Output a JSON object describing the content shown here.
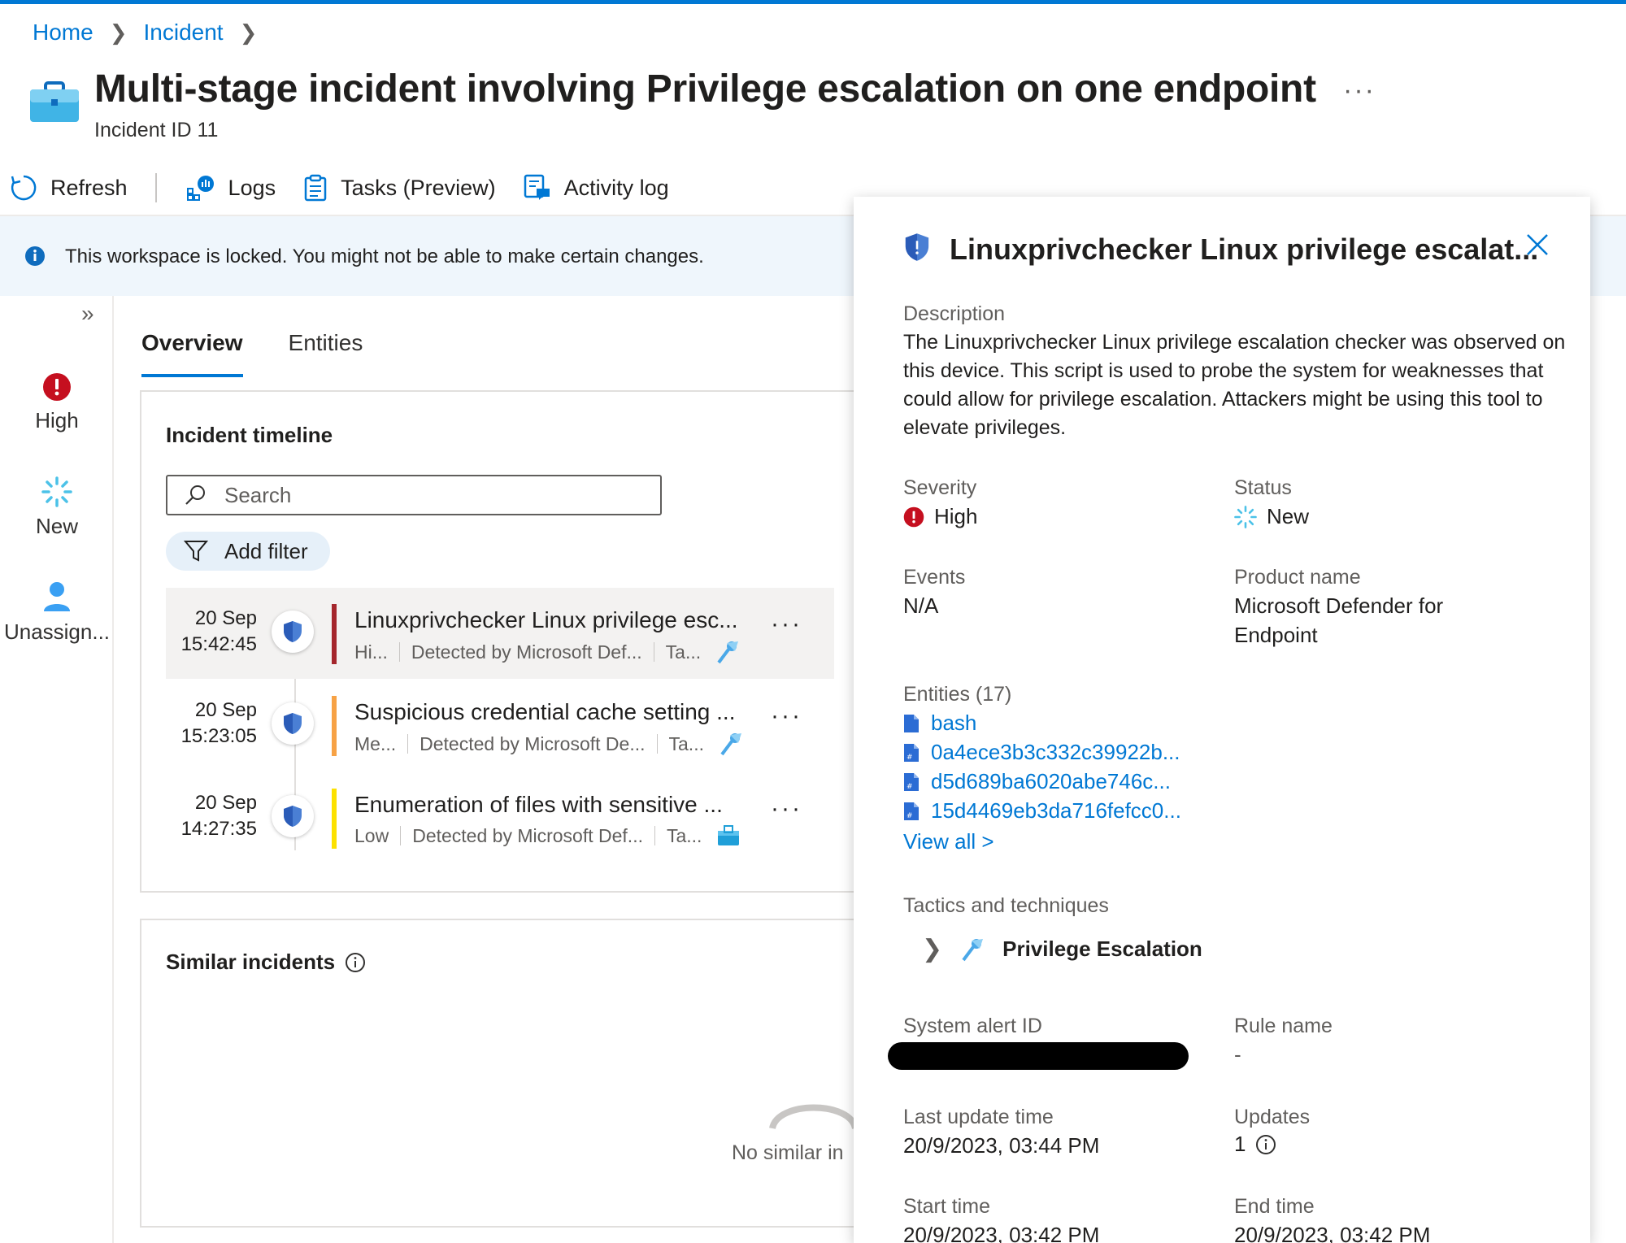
{
  "breadcrumb": {
    "home": "Home",
    "incident": "Incident"
  },
  "header": {
    "title": "Multi-stage incident involving Privilege escalation on one endpoint",
    "subtitle": "Incident ID 11",
    "more": "···"
  },
  "toolbar": {
    "refresh": "Refresh",
    "logs": "Logs",
    "tasks": "Tasks (Preview)",
    "activity": "Activity log"
  },
  "banner": {
    "text": "This workspace is locked. You might not be able to make certain changes."
  },
  "rail": {
    "severity": "High",
    "status": "New",
    "owner": "Unassign..."
  },
  "tabs": [
    "Overview",
    "Entities"
  ],
  "timeline": {
    "title": "Incident timeline",
    "search_placeholder": "Search",
    "add_filter": "Add filter",
    "alerts": [
      {
        "date": "20 Sep",
        "time": "15:42:45",
        "name": "Linuxprivchecker Linux privilege esc...",
        "sev": "Hi...",
        "source": "Detected by Microsoft Def...",
        "tactic": "Ta...",
        "color": "#a4262c"
      },
      {
        "date": "20 Sep",
        "time": "15:23:05",
        "name": "Suspicious credential cache setting ...",
        "sev": "Me...",
        "source": "Detected by Microsoft De...",
        "tactic": "Ta...",
        "color": "#f7a245"
      },
      {
        "date": "20 Sep",
        "time": "14:27:35",
        "name": "Enumeration of files with sensitive ...",
        "sev": "Low",
        "source": "Detected by Microsoft Def...",
        "tactic": "Ta...",
        "color": "#fce100"
      }
    ]
  },
  "similar": {
    "title": "Similar incidents",
    "empty": "No similar in"
  },
  "panel": {
    "title": "Linuxprivchecker Linux privilege escalat...",
    "description_label": "Description",
    "description": "The Linuxprivchecker Linux privilege escalation checker was observed on this device. This script is used to probe the system for weaknesses that could allow for privilege escalation. Attackers might be using this tool to elevate privileges.",
    "severity_label": "Severity",
    "severity": "High",
    "status_label": "Status",
    "status": "New",
    "events_label": "Events",
    "events": "N/A",
    "product_label": "Product name",
    "product_line1": "Microsoft Defender for",
    "product_line2": "Endpoint",
    "entities_label": "Entities (17)",
    "entities": [
      "bash",
      "0a4ece3b3c332c39922b...",
      "d5d689ba6020abe746c...",
      "15d4469eb3da716fefcc0..."
    ],
    "view_all": "View all >",
    "tactics_label": "Tactics and techniques",
    "tactic": "Privilege Escalation",
    "alert_id_label": "System alert ID",
    "rule_label": "Rule name",
    "rule": "-",
    "last_update_label": "Last update time",
    "last_update": "20/9/2023, 03:44 PM",
    "updates_label": "Updates",
    "updates": "1",
    "start_label": "Start time",
    "start": "20/9/2023, 03:42 PM",
    "end_label": "End time",
    "end": "20/9/2023, 03:42 PM"
  },
  "colors": {
    "accent": "#0078d4",
    "high": "#c50f1f",
    "banner": "#eff6fc"
  }
}
